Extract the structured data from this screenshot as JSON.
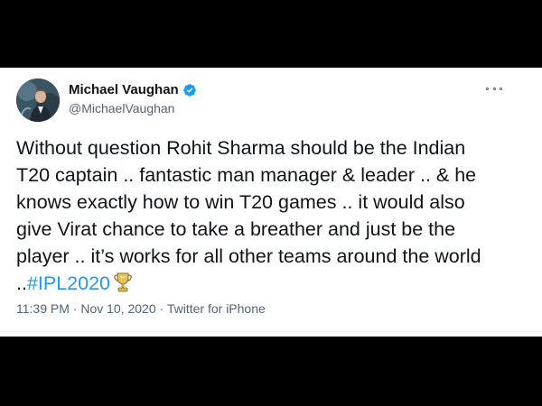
{
  "tweet": {
    "author": {
      "display_name": "Michael Vaughan",
      "handle": "@MichaelVaughan",
      "verified": true,
      "avatar_icon": "profile-photo"
    },
    "more_icon": "more-dots-icon",
    "text_lines": [
      "Without question Rohit Sharma  should be the Indian",
      "T20 captain .. fantastic man manager & leader .. & he",
      "knows exactly how to win T20 games .. it would also",
      "give Virat chance to take a breather and just be the",
      "player .. it’s works for all other teams around the world"
    ],
    "last_line_prefix": "..",
    "hashtag": "#IPL2020",
    "emoji_icon": "trophy-icon",
    "time": "11:39 PM",
    "separator": "·",
    "date": "Nov 10, 2020",
    "source": "Twitter for iPhone"
  },
  "colors": {
    "link": "#1d9bf0",
    "text": "#0f1419",
    "secondary": "#536471",
    "verified": "#1d9bf0"
  }
}
